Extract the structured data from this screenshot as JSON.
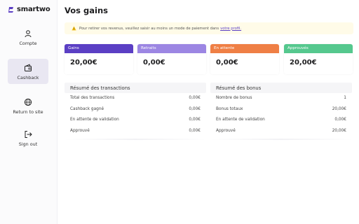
{
  "app": {
    "name": "smartwo",
    "brand_color": "#5b3fc4"
  },
  "sidebar": {
    "items": [
      {
        "label": "Compte",
        "icon": "user-icon",
        "active": false
      },
      {
        "label": "Cashback",
        "icon": "wallet-icon",
        "active": true
      },
      {
        "label": "Return to site",
        "icon": "globe-icon",
        "active": false
      },
      {
        "label": "Sign out",
        "icon": "sign-out-icon",
        "active": false
      }
    ]
  },
  "page": {
    "title": "Vos gains"
  },
  "warning": {
    "text": "Pour retirer vos revenus, veuillez saisir au moins un mode de paiement dans",
    "link": "votre profil."
  },
  "stats": [
    {
      "label": "Gains",
      "value": "20,00€",
      "color": "#5b3fc4"
    },
    {
      "label": "Retraits",
      "value": "0,00€",
      "color": "#9c86e3"
    },
    {
      "label": "En attente",
      "value": "0,00€",
      "color": "#ef7f45"
    },
    {
      "label": "Approuvés",
      "value": "20,00€",
      "color": "#55c88e"
    }
  ],
  "transactions": {
    "title": "Résumé des transactions",
    "rows": [
      {
        "label": "Total des transactions",
        "value": "0,00€"
      },
      {
        "label": "Cashback gagné",
        "value": "0,00€"
      },
      {
        "label": "En attente de validation",
        "value": "0,00€"
      },
      {
        "label": "Approuvé",
        "value": "0,00€"
      }
    ]
  },
  "bonus": {
    "title": "Résumé des bonus",
    "rows": [
      {
        "label": "Nombre de bonus",
        "value": "1"
      },
      {
        "label": "Bonus totaux",
        "value": "20,00€"
      },
      {
        "label": "En attente de validation",
        "value": "0,00€"
      },
      {
        "label": "Approuvé",
        "value": "20,00€"
      }
    ]
  }
}
